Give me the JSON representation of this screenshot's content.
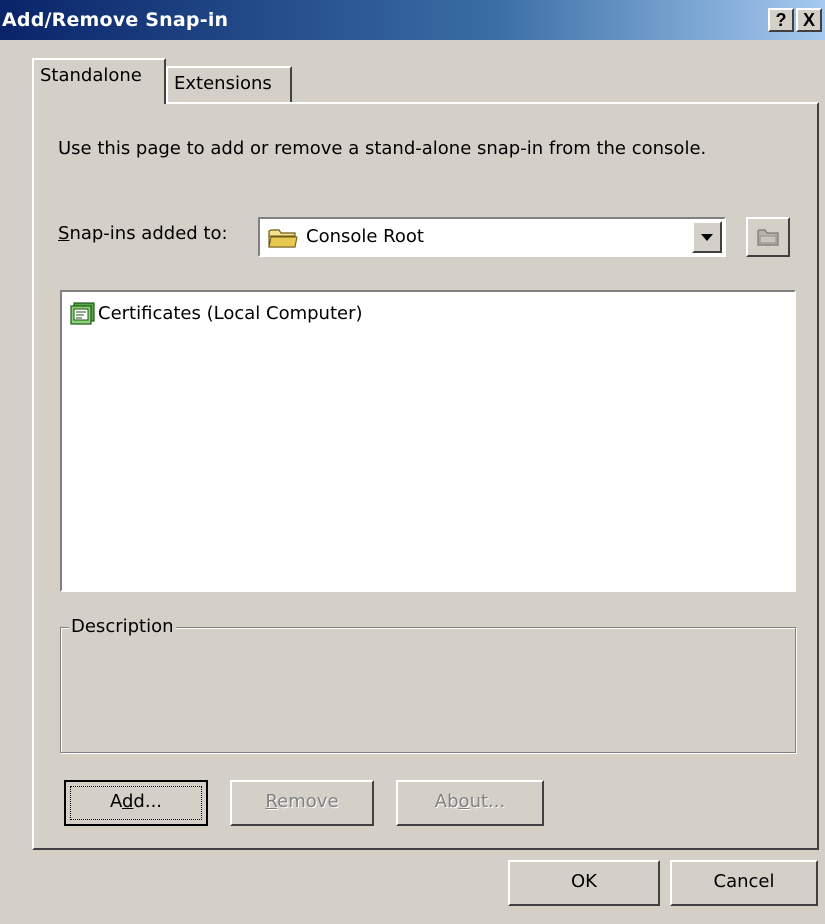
{
  "window": {
    "title": "Add/Remove Snap-in",
    "help_label": "?",
    "close_label": "X"
  },
  "tabs": [
    {
      "label": "Standalone",
      "selected": true
    },
    {
      "label": "Extensions",
      "selected": false
    }
  ],
  "page": {
    "intro": "Use this page to add or remove a stand-alone snap-in from the console.",
    "snapins_label_mnemonic": "S",
    "snapins_label_rest": "nap-ins added to:",
    "combo": {
      "value": "Console Root",
      "icon": "folder-icon"
    },
    "browse_icon": "folder-up-icon",
    "list_items": [
      {
        "label": "Certificates (Local Computer)",
        "icon": "certificate-snapin-icon"
      }
    ],
    "description": {
      "label": "Description",
      "text": ""
    }
  },
  "buttons": {
    "add": {
      "pre": "A",
      "mnemonic": "d",
      "post": "d..."
    },
    "remove": {
      "pre": "",
      "mnemonic": "R",
      "post": "emove"
    },
    "about": {
      "pre": "Ab",
      "mnemonic": "o",
      "post": "ut..."
    },
    "ok": "OK",
    "cancel": "Cancel"
  },
  "colors": {
    "face": "#d4d0c8",
    "title_active_start": "#0a246a",
    "title_active_end": "#a6caf0",
    "disabled_text": "#808080"
  }
}
